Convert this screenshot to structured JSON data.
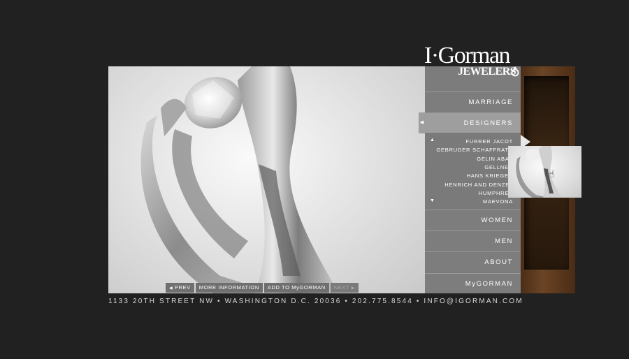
{
  "brand": {
    "logo_main": "I·Gorman",
    "logo_sub": "JEWELERS"
  },
  "image_toolbar": {
    "prev": "PREV",
    "more_info": "MORE INFORMATION",
    "add_to_mygorman": "ADD TO MyGORMAN",
    "next": "NEXT"
  },
  "nav": {
    "items": [
      {
        "label": "MARRIAGE"
      },
      {
        "label": "DESIGNERS"
      },
      {
        "label": "WOMEN"
      },
      {
        "label": "MEN"
      },
      {
        "label": "ABOUT"
      },
      {
        "label": "MyGORMAN"
      }
    ],
    "active": "DESIGNERS",
    "designers": [
      "FURRER JACOT",
      "GEBRUDER SCHAFFRATH",
      "GELIN ABAZ",
      "GELLNER",
      "HANS KRIEGER",
      "HENRICH AND DENZEL",
      "HUMPHREY",
      "MAEVONA"
    ]
  },
  "footer": {
    "address": "1133 20TH STREET NW • WASHINGTON D.C. 20036 • 202.775.8544 • INFO@IGORMAN.COM"
  },
  "colors": {
    "background": "#212121",
    "nav": "#7d7d7d",
    "nav_active": "#9e9e9e",
    "wood": "#6b4424"
  }
}
